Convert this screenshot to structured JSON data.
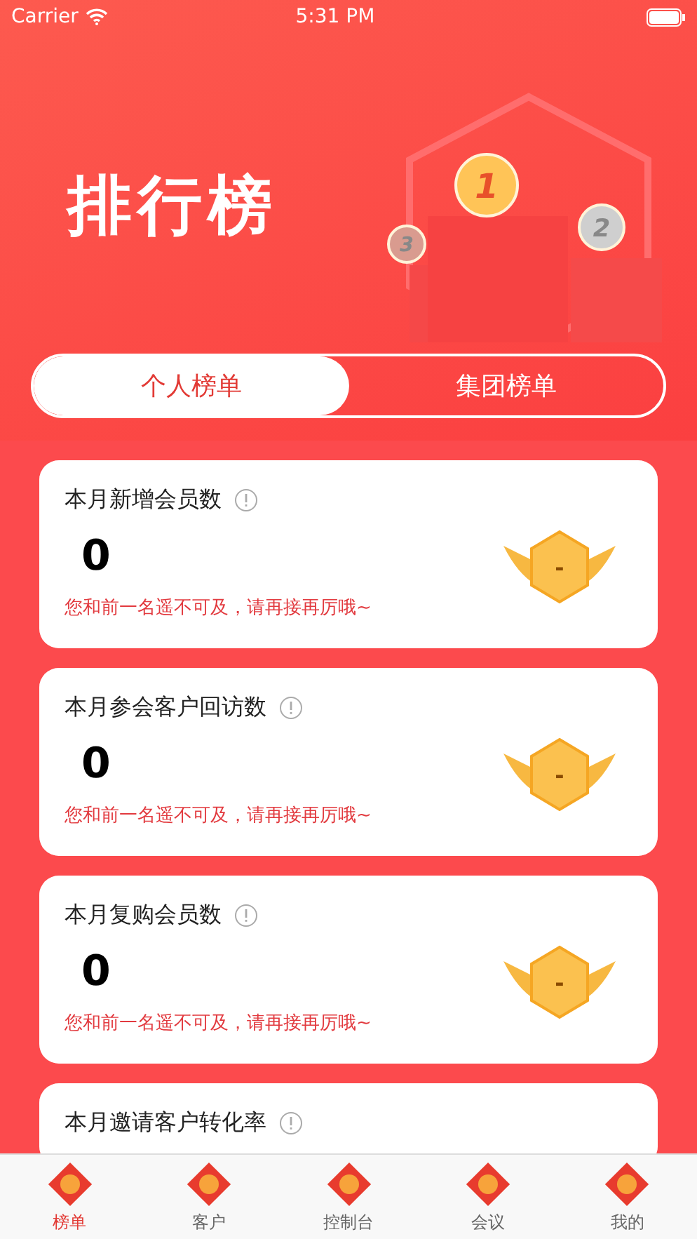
{
  "status_bar": {
    "carrier": "Carrier",
    "time": "5:31 PM"
  },
  "header": {
    "title": "排行榜",
    "podium": [
      {
        "place": "3"
      },
      {
        "place": "1"
      },
      {
        "place": "2"
      }
    ]
  },
  "tabs": [
    {
      "label": "个人榜单",
      "selected": true
    },
    {
      "label": "集团榜单",
      "selected": false
    }
  ],
  "cards": [
    {
      "title": "本月新增会员数",
      "value": "0",
      "rank": "-",
      "message": "您和前一名遥不可及，请再接再厉哦~"
    },
    {
      "title": "本月参会客户回访数",
      "value": "0",
      "rank": "-",
      "message": "您和前一名遥不可及，请再接再厉哦~"
    },
    {
      "title": "本月复购会员数",
      "value": "0",
      "rank": "-",
      "message": "您和前一名遥不可及，请再接再厉哦~"
    },
    {
      "title": "本月邀请客户转化率"
    }
  ],
  "tab_bar": [
    {
      "label": "榜单",
      "selected": true
    },
    {
      "label": "客户",
      "selected": false
    },
    {
      "label": "控制台",
      "selected": false
    },
    {
      "label": "会议",
      "selected": false
    },
    {
      "label": "我的",
      "selected": false
    }
  ]
}
